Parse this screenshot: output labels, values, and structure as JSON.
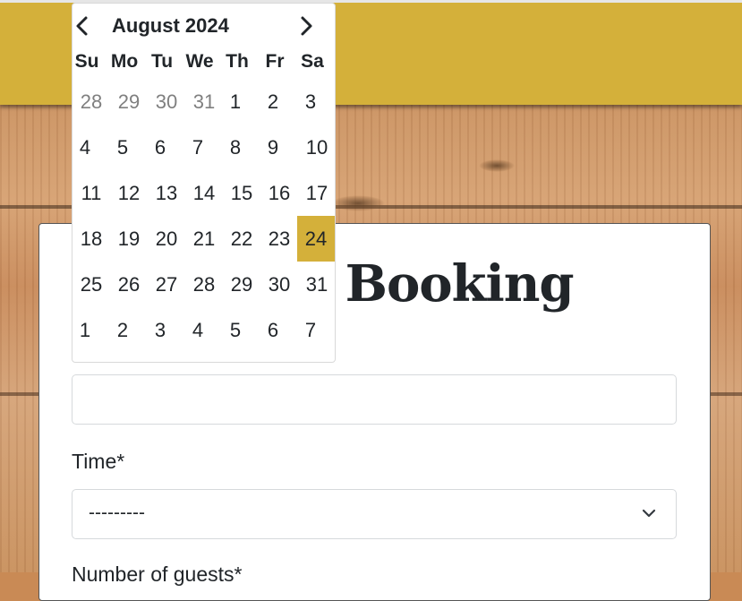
{
  "datepicker": {
    "month_label": "August 2024",
    "weekdays": [
      "Su",
      "Mo",
      "Tu",
      "We",
      "Th",
      "Fr",
      "Sa"
    ],
    "weeks": [
      [
        {
          "d": "28",
          "other": true
        },
        {
          "d": "29",
          "other": true
        },
        {
          "d": "30",
          "other": true
        },
        {
          "d": "31",
          "other": true
        },
        {
          "d": "1"
        },
        {
          "d": "2"
        },
        {
          "d": "3"
        }
      ],
      [
        {
          "d": "4"
        },
        {
          "d": "5"
        },
        {
          "d": "6"
        },
        {
          "d": "7"
        },
        {
          "d": "8"
        },
        {
          "d": "9"
        },
        {
          "d": "10"
        }
      ],
      [
        {
          "d": "11"
        },
        {
          "d": "12"
        },
        {
          "d": "13"
        },
        {
          "d": "14"
        },
        {
          "d": "15"
        },
        {
          "d": "16"
        },
        {
          "d": "17"
        }
      ],
      [
        {
          "d": "18"
        },
        {
          "d": "19"
        },
        {
          "d": "20"
        },
        {
          "d": "21"
        },
        {
          "d": "22"
        },
        {
          "d": "23"
        },
        {
          "d": "24",
          "selected": true
        }
      ],
      [
        {
          "d": "25"
        },
        {
          "d": "26"
        },
        {
          "d": "27"
        },
        {
          "d": "28"
        },
        {
          "d": "29"
        },
        {
          "d": "30"
        },
        {
          "d": "31"
        }
      ],
      [
        {
          "d": "1",
          "other": true,
          "offset_align": "left"
        },
        {
          "d": "2",
          "other": true
        },
        {
          "d": "3",
          "other": true
        },
        {
          "d": "4",
          "other": true
        },
        {
          "d": "5",
          "other": true
        },
        {
          "d": "6",
          "other": true
        },
        {
          "d": "7",
          "other": true
        }
      ]
    ],
    "prev_icon": "chevron-left-icon",
    "next_icon": "chevron-right-icon"
  },
  "form": {
    "title_visible": "e Booking",
    "date_value": "",
    "time_label": "Time*",
    "time_value": "---------",
    "guests_label_partial": "Number of guests*"
  },
  "colors": {
    "accent": "#d4b03a",
    "text": "#212529",
    "muted": "#7f7f7f"
  }
}
